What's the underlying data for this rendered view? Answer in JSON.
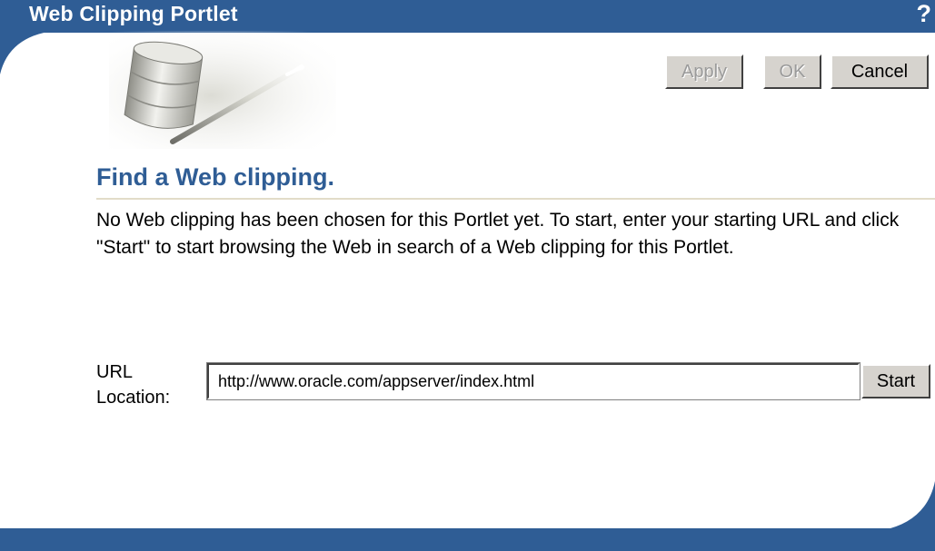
{
  "header": {
    "title": "Web Clipping Portlet",
    "help_label": "?"
  },
  "toolbar": {
    "apply_label": "Apply",
    "ok_label": "OK",
    "cancel_label": "Cancel"
  },
  "main": {
    "heading": "Find a Web clipping.",
    "description": "No Web clipping has been chosen for this Portlet yet. To start, enter your starting URL and click \"Start\" to start browsing the Web in search of a Web clipping for this Portlet.",
    "url_label": "URL Location:",
    "url_value": "http://www.oracle.com/appserver/index.html",
    "start_label": "Start"
  },
  "colors": {
    "brand_blue": "#2f5d95",
    "button_face": "#d6d3ce",
    "rule": "#e2dcc8"
  },
  "icons": {
    "help": "help-icon",
    "illustration": "database-cylinder-illustration"
  }
}
